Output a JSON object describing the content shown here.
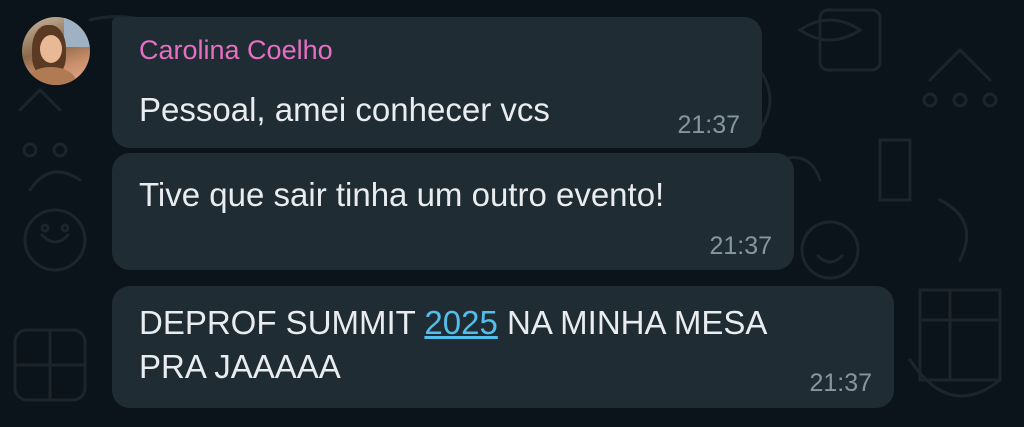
{
  "sender": {
    "name": "Carolina Coelho",
    "name_color": "#e66fc4",
    "avatar": "profile-photo"
  },
  "theme": {
    "background": "#0b141a",
    "bubble": "#202c33",
    "text": "#e9edef",
    "meta": "#8696a0",
    "link": "#53bdeb"
  },
  "messages": [
    {
      "text": "Pessoal, amei conhecer vcs",
      "time": "21:37"
    },
    {
      "text": "Tive que sair tinha um outro evento!",
      "time": "21:37"
    },
    {
      "line1_before": "DEPROF SUMMIT ",
      "line1_link": "2025",
      "line1_after": " NA MINHA MESA",
      "line2": "PRA JAAAAA",
      "time": "21:37"
    }
  ]
}
